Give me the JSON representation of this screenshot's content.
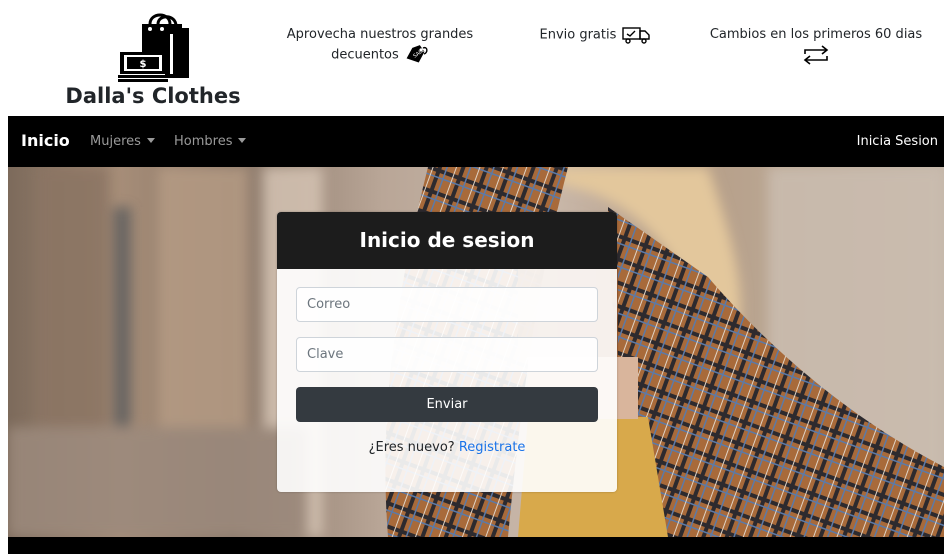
{
  "header": {
    "brand_name": "Dalla's Clothes",
    "logo_icon": "shopping-bags-money-icon",
    "promos": [
      {
        "text": "Aprovecha nuestros grandes decuentos",
        "icon": "sale-tag-icon"
      },
      {
        "text": "Envio gratis",
        "icon": "delivery-truck-icon"
      },
      {
        "text": "Cambios en los primeros 60 dias",
        "icon": "exchange-arrows-icon"
      }
    ]
  },
  "navbar": {
    "home": "Inicio",
    "mujeres": "Mujeres",
    "hombres": "Hombres",
    "login": "Inicia Sesion"
  },
  "login": {
    "title": "Inicio de sesion",
    "email_placeholder": "Correo",
    "password_placeholder": "Clave",
    "submit": "Enviar",
    "register_prompt": "¿Eres nuevo?",
    "register_link": "Registrate"
  },
  "colors": {
    "navbar_bg": "#000000",
    "card_header_bg": "#1c1c1c",
    "button_bg": "#343a40",
    "link": "#1a73e8"
  }
}
